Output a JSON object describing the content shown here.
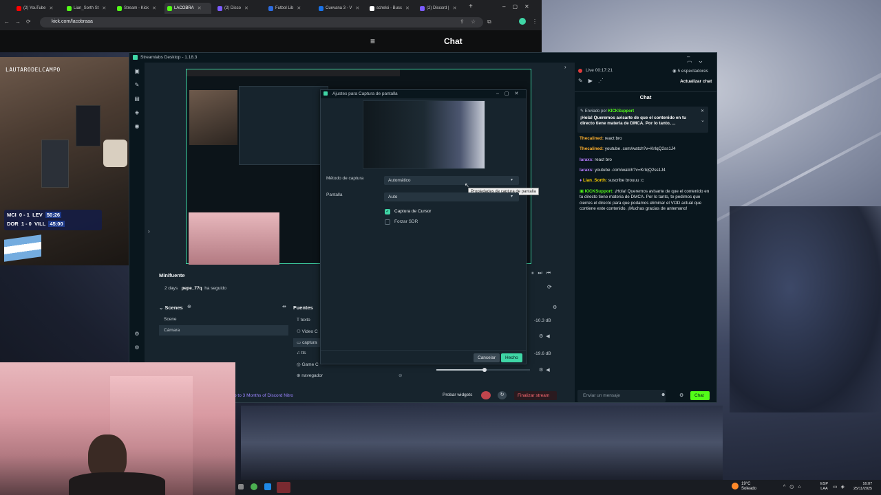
{
  "browser": {
    "tabs": [
      {
        "title": "(2) YouTube",
        "color": "#ff0000"
      },
      {
        "title": "Lian_Sorth St",
        "color": "#53fc18"
      },
      {
        "title": "Stream - Kick",
        "color": "#53fc18"
      },
      {
        "title": "LACOBRA",
        "color": "#53fc18"
      },
      {
        "title": "(2) Disco",
        "color": "#7c5cff"
      },
      {
        "title": "Futbol Lib",
        "color": "#2d6cdf"
      },
      {
        "title": "Cuevana 3 - V",
        "color": "#1a73e8"
      },
      {
        "title": "schelsi - Busc",
        "color": "#ffffff"
      },
      {
        "title": "(2) Discord |",
        "color": "#7c5cff"
      }
    ],
    "url": "kick.com/lacobraaa",
    "kick_chat_title": "Chat"
  },
  "overlay": {
    "streamer_tag": "LAUTARODELCAMPO",
    "scores": [
      {
        "home": "MCI",
        "score": "0 - 1",
        "away": "LEV",
        "time": "50:26"
      },
      {
        "home": "DOR",
        "score": "1 - 0",
        "away": "VILL",
        "time": "45:00"
      }
    ]
  },
  "streamlabs": {
    "title": "Streamlabs Desktop - 1.18.3",
    "live_time": "Live 00:17:21",
    "viewers": "5 espectadores",
    "update_chat": "Actualizar chat",
    "chat_header": "Chat",
    "pinned": {
      "sent_by": "Enviado por",
      "user": "KICKSupport",
      "text": "¡Hola! Queremos avisarte de que el contenido en tu directo tiene materia de DMCA. Por lo tanto, ..."
    },
    "messages": [
      {
        "user": "Thecalined:",
        "text": "react bro",
        "color": "#ffb02e"
      },
      {
        "user": "Thecalined:",
        "text": "youtube .com/watch?v=KrIqQ2ss1J4",
        "color": "#ffb02e"
      },
      {
        "user": "laraxs:",
        "text": "react bro",
        "color": "#b77cff"
      },
      {
        "user": "laraxs:",
        "text": "youtube .com/watch?v=KrIqQ2ss1J4",
        "color": "#b77cff"
      },
      {
        "user": "Lian_Sorth:",
        "text": "suscribe brouuu :c",
        "color": "#ffd000"
      },
      {
        "user": "KICKSupport:",
        "text": "¡Hola! Queremos avisarte de que el contenido en tu directo tiene materia de DMCA. Por lo tanto, te pedimos que cierres el directo para que podamos eliminar el VOD actual que contiene este contenido. ¡Muchas gracias de antemano!",
        "color": "#53fc18"
      }
    ],
    "chat_input_placeholder": "Enviar un mensaje",
    "chat_button": "Chat",
    "minifeed_title": "Minifuente",
    "event": {
      "ago": "2 days",
      "user": "pepe_77q",
      "action": "ha seguido"
    },
    "scenes_title": "Scenes",
    "scenes": [
      "Scene",
      "Cámara"
    ],
    "sources_title": "Fuentes",
    "sources": [
      "texto",
      "Video C",
      "captura",
      "tts",
      "Game C",
      "navegador"
    ],
    "mixer": [
      "-10.3 dB",
      "-19.6 dB"
    ],
    "footer": {
      "promo": "p to 3 Months of Discord Nitro",
      "test_widgets": "Probar widgets",
      "end_stream": "Finalizar stream"
    }
  },
  "dialog": {
    "title": "Ajustes para Captura de pantalla",
    "capture_method_label": "Método de captura",
    "capture_method_value": "Automático",
    "tooltip": "Propiedades de captura de pantalla",
    "screen_label": "Pantalla",
    "screen_value": "Auto",
    "cursor_capture": "Captura de Cursor",
    "cursor_checked": true,
    "force_sdr": "Forzar SDR",
    "force_sdr_checked": false,
    "cancel": "Cancelar",
    "done": "Hecho"
  },
  "taskbar": {
    "weather_temp": "19°C",
    "weather_text": "Soleado",
    "lang": "ESP",
    "lang_sub": "LAA",
    "time": "16:07",
    "date": "25/11/2025"
  }
}
